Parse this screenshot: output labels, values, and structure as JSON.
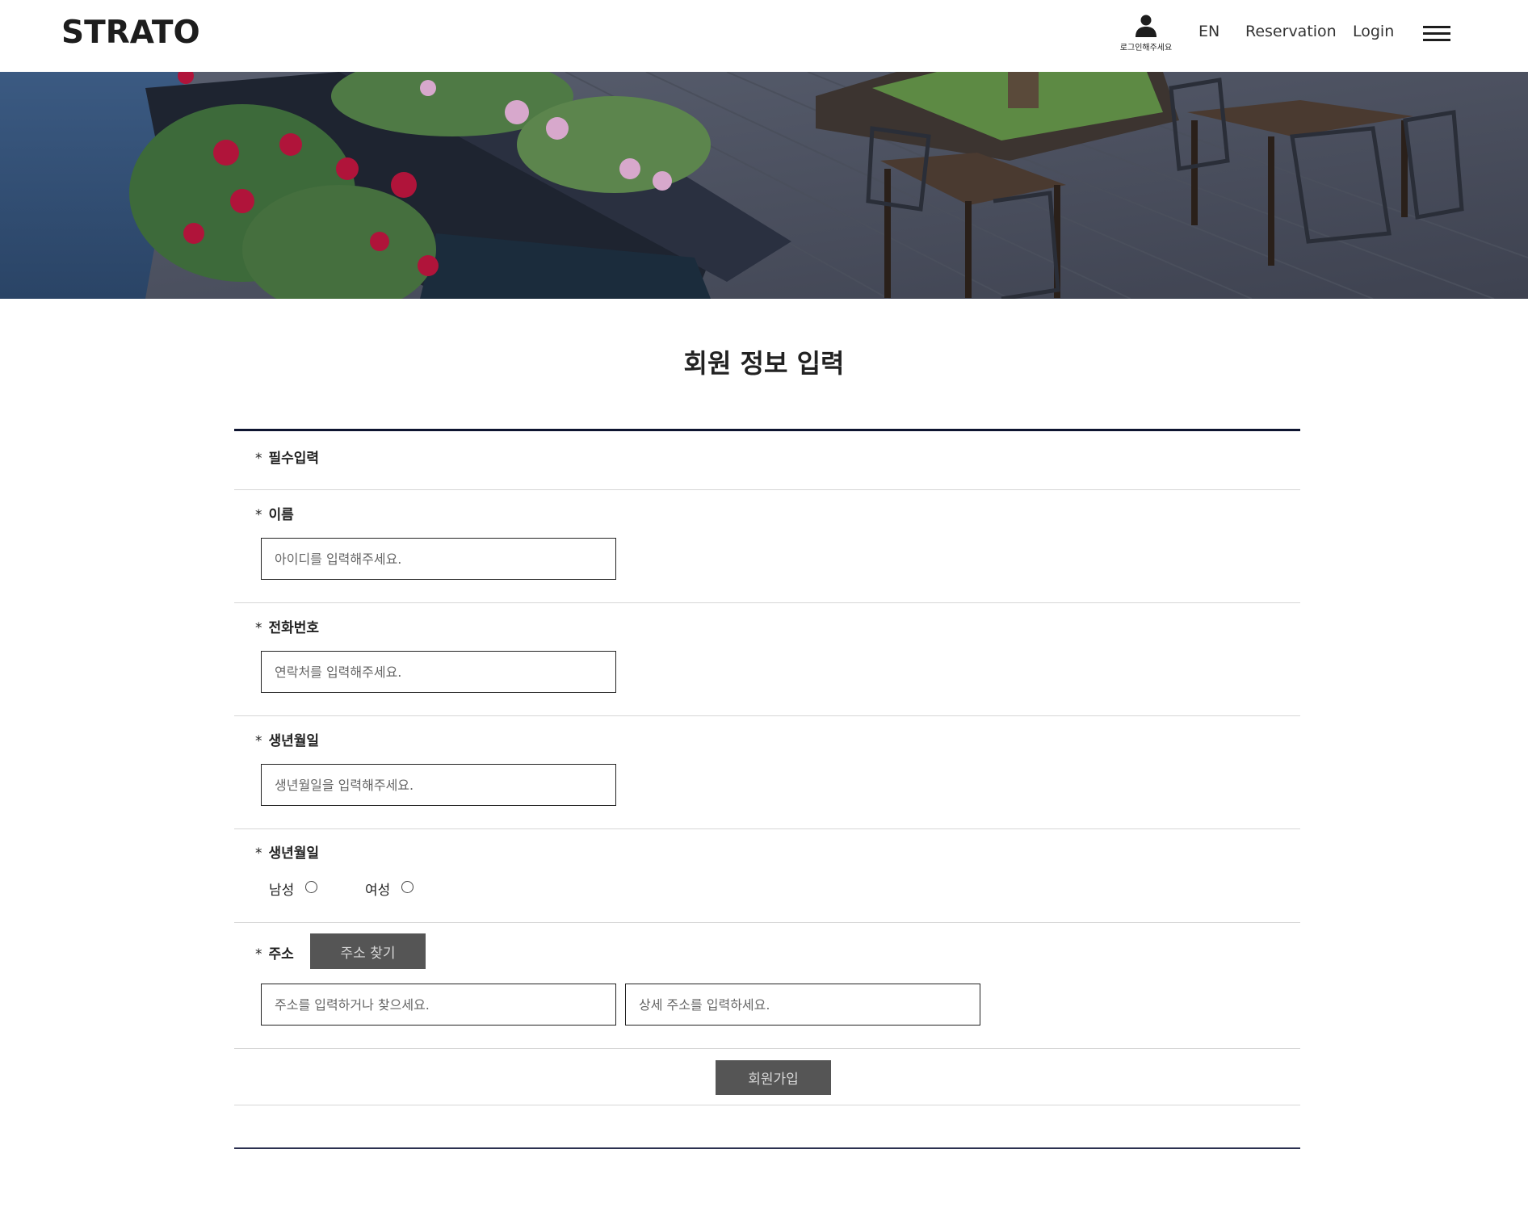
{
  "header": {
    "logo": "STRATO",
    "user_caption": "로그인해주세요",
    "nav": {
      "lang": "EN",
      "reservation": "Reservation",
      "login": "Login"
    }
  },
  "page_title": "회원 정보 입력",
  "form": {
    "required_note": "필수입력",
    "required_mark": "*",
    "name": {
      "label": "이름",
      "placeholder": "아이디를 입력해주세요."
    },
    "phone": {
      "label": "전화번호",
      "placeholder": "연락처를 입력해주세요."
    },
    "birthdate": {
      "label": "생년월일",
      "placeholder": "생년월일을 입력해주세요."
    },
    "gender": {
      "label": "생년월일",
      "male": "남성",
      "female": "여성"
    },
    "address": {
      "label": "주소",
      "search_button": "주소 찾기",
      "placeholder": "주소를 입력하거나 찾으세요.",
      "detail_placeholder": "상세 주소를 입력하세요."
    },
    "submit": "회원가입"
  }
}
